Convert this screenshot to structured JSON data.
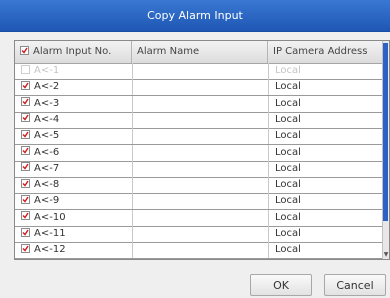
{
  "dialog": {
    "title": "Copy Alarm Input"
  },
  "table": {
    "headers": {
      "col1": "Alarm Input No.",
      "col2": "Alarm Name",
      "col3": "IP Camera Address"
    },
    "rows": [
      {
        "no": "A<-1",
        "name": "",
        "address": "Local",
        "checked": false,
        "disabled": true
      },
      {
        "no": "A<-2",
        "name": "",
        "address": "Local",
        "checked": true,
        "disabled": false
      },
      {
        "no": "A<-3",
        "name": "",
        "address": "Local",
        "checked": true,
        "disabled": false
      },
      {
        "no": "A<-4",
        "name": "",
        "address": "Local",
        "checked": true,
        "disabled": false
      },
      {
        "no": "A<-5",
        "name": "",
        "address": "Local",
        "checked": true,
        "disabled": false
      },
      {
        "no": "A<-6",
        "name": "",
        "address": "Local",
        "checked": true,
        "disabled": false
      },
      {
        "no": "A<-7",
        "name": "",
        "address": "Local",
        "checked": true,
        "disabled": false
      },
      {
        "no": "A<-8",
        "name": "",
        "address": "Local",
        "checked": true,
        "disabled": false
      },
      {
        "no": "A<-9",
        "name": "",
        "address": "Local",
        "checked": true,
        "disabled": false
      },
      {
        "no": "A<-10",
        "name": "",
        "address": "Local",
        "checked": true,
        "disabled": false
      },
      {
        "no": "A<-11",
        "name": "",
        "address": "Local",
        "checked": true,
        "disabled": false
      },
      {
        "no": "A<-12",
        "name": "",
        "address": "Local",
        "checked": true,
        "disabled": false
      }
    ]
  },
  "buttons": {
    "ok": "OK",
    "cancel": "Cancel"
  },
  "colors": {
    "title_bar": "#2563c4",
    "check": "#d11a1a",
    "scroll_thumb": "#2c62c8"
  }
}
